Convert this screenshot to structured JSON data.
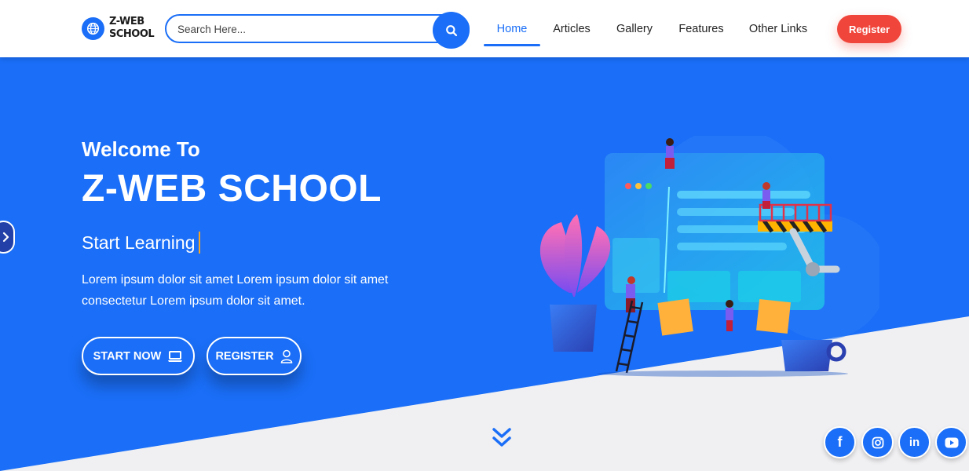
{
  "navbar": {
    "logo": {
      "line1": "Z-WEB",
      "line2": "SCHOOL",
      "icon": "globe-icon"
    },
    "search": {
      "placeholder": "Search Here...",
      "value": "",
      "icon": "search-icon"
    },
    "links": [
      {
        "label": "Home",
        "active": true
      },
      {
        "label": "Articles",
        "active": false
      },
      {
        "label": "Gallery",
        "active": false
      },
      {
        "label": "Features",
        "active": false
      },
      {
        "label": "Other Links",
        "active": false
      }
    ],
    "register_label": "Register"
  },
  "hero": {
    "welcome": "Welcome To",
    "title": "Z-WEB SCHOOL",
    "typed_text": "Start Learning",
    "description": "Lorem ipsum dolor sit amet Lorem ipsum dolor sit amet consectetur Lorem ipsum dolor sit amet.",
    "buttons": {
      "start": {
        "label": "START NOW",
        "icon": "laptop-icon"
      },
      "register": {
        "label": "REGISTER",
        "icon": "user-icon"
      }
    },
    "scroll_icon": "double-chevron-down-icon",
    "side_arrow_icon": "chevron-right-icon"
  },
  "socials": [
    {
      "name": "facebook",
      "glyph": "f"
    },
    {
      "name": "instagram",
      "glyph": ""
    },
    {
      "name": "linkedin",
      "glyph": "in"
    },
    {
      "name": "youtube",
      "glyph": ""
    }
  ],
  "colors": {
    "primary": "#1a6ef7",
    "accent": "#f0453a",
    "cursor": "#f5a623",
    "background_lower": "#f0f0f2"
  }
}
